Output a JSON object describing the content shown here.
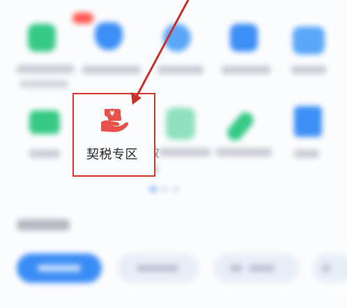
{
  "focused_item": {
    "label": "契税专区",
    "icon": "tax-zone-icon",
    "icon_glyph": "¥",
    "icon_color": "#e8504a"
  },
  "partial_label": "救",
  "colors": {
    "highlight_border": "#d6372f",
    "arrow": "#c9302b",
    "accent_blue": "#3a8cf5",
    "accent_green": "#36c985"
  }
}
